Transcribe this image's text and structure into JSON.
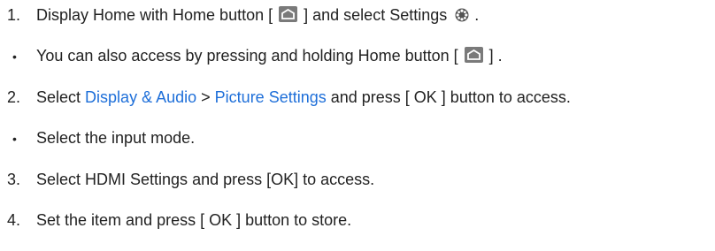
{
  "steps": [
    {
      "number": "1.",
      "pre": "Display Home with Home button [",
      "mid": "] and select Settings",
      "post": "."
    },
    {
      "bullet": "•",
      "pre": "You can also access by pressing and holding Home button [",
      "post": "] ."
    },
    {
      "number": "2.",
      "pre": "Select",
      "link1": "Display & Audio",
      "sep": ">",
      "link2": "Picture Settings",
      "post": "and press [ OK ] button to access."
    },
    {
      "bullet": "•",
      "text": "Select the input mode."
    },
    {
      "number": "3.",
      "text": "Select HDMI Settings and press [OK] to access."
    },
    {
      "number": "4.",
      "text": "Set the item and press [ OK ] button to store."
    }
  ],
  "colors": {
    "link": "#1e6fd9",
    "icon_bg": "#7a7a7a",
    "text": "#222222"
  },
  "icons": [
    "home-icon",
    "settings-gear-icon"
  ]
}
